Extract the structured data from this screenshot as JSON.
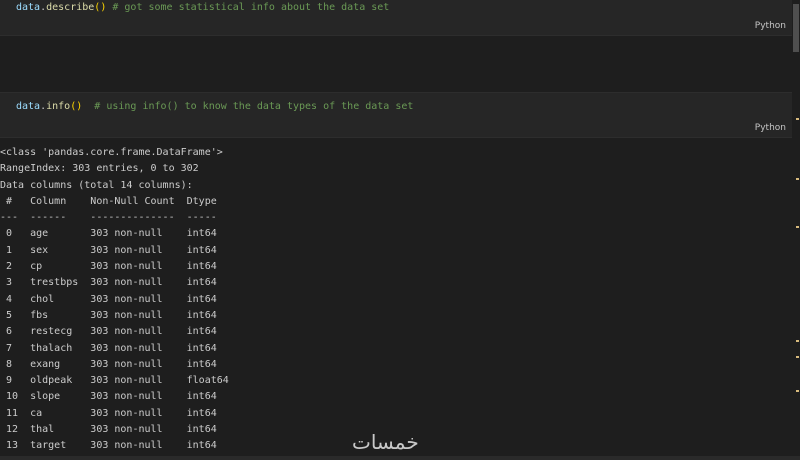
{
  "cell1": {
    "obj": "data",
    "dot": ".",
    "fn": "describe",
    "parens": "()",
    "comment": " # got some statistical info about the data set",
    "language": "Python"
  },
  "cell2": {
    "obj": "data",
    "dot": ".",
    "fn": "info",
    "parens": "()",
    "comment": "  # using info() to know the data types of the data set",
    "language": "Python"
  },
  "output": {
    "lines": [
      "<class 'pandas.core.frame.DataFrame'>",
      "RangeIndex: 303 entries, 0 to 302",
      "Data columns (total 14 columns):",
      " #   Column    Non-Null Count  Dtype  ",
      "---  ------    --------------  -----  ",
      " 0   age       303 non-null    int64  ",
      " 1   sex       303 non-null    int64  ",
      " 2   cp        303 non-null    int64  ",
      " 3   trestbps  303 non-null    int64  ",
      " 4   chol      303 non-null    int64  ",
      " 5   fbs       303 non-null    int64  ",
      " 6   restecg   303 non-null    int64  ",
      " 7   thalach   303 non-null    int64  ",
      " 8   exang     303 non-null    int64  ",
      " 9   oldpeak   303 non-null    float64",
      " 10  slope     303 non-null    int64  ",
      " 11  ca        303 non-null    int64  ",
      " 12  thal      303 non-null    int64  ",
      " 13  target    303 non-null    int64  "
    ]
  },
  "watermark": "خمسات",
  "colors": {
    "background": "#1e1e1e",
    "cell": "#262626",
    "function": "#dcdcaa",
    "variable": "#9cdcfe",
    "bracket": "#ffd700",
    "comment": "#6a9955"
  }
}
